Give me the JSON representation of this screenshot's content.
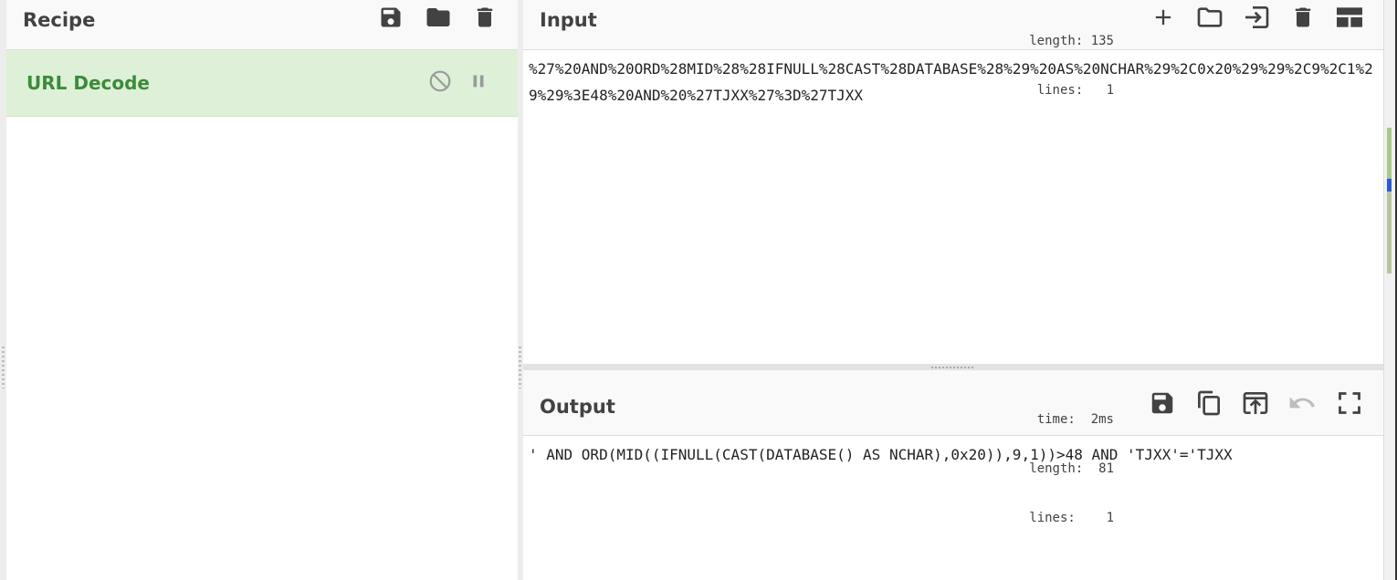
{
  "recipe": {
    "title": "Recipe",
    "operations": [
      {
        "name": "URL Decode"
      }
    ]
  },
  "input": {
    "title": "Input",
    "stats": {
      "length_label": "length:",
      "length": "135",
      "lines_label": "lines:",
      "lines": "1"
    },
    "text": "%27%20AND%20ORD%28MID%28%28IFNULL%28CAST%28DATABASE%28%29%20AS%20NCHAR%29%2C0x20%29%29%2C9%2C1%29%29%3E48%20AND%20%27TJXX%27%3D%27TJXX"
  },
  "output": {
    "title": "Output",
    "stats": {
      "time_label": "time:",
      "time": "2ms",
      "length_label": "length:",
      "length": "81",
      "lines_label": "lines:",
      "lines": "1"
    },
    "text": "' AND ORD(MID((IFNULL(CAST(DATABASE() AS NCHAR),0x20)),9,1))>48 AND 'TJXX'='TJXX"
  },
  "colors": {
    "operation_bg": "#dff0d8",
    "operation_text": "#3c8b3c",
    "icon": "#424242",
    "icon_disabled": "#bdbdbd"
  }
}
